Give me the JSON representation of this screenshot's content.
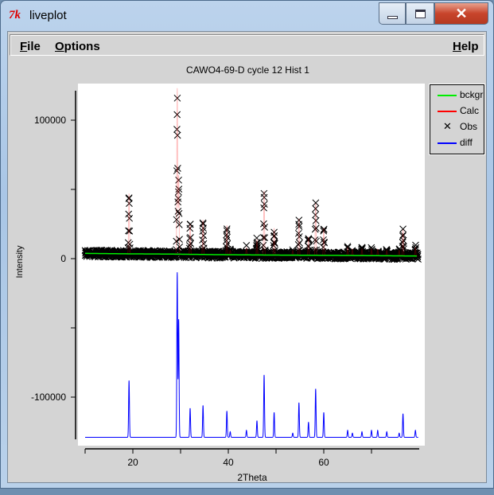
{
  "window": {
    "title": "liveplot",
    "icon": "tk-feather-icon",
    "buttons": [
      "minimize",
      "maximize",
      "close"
    ]
  },
  "menu": {
    "file": "File",
    "options": "Options",
    "help": "Help"
  },
  "chart_data": {
    "type": "line",
    "title": "CAWO4-69-D cycle 12 Hist 1",
    "xlabel": "2Theta",
    "ylabel": "Intensity",
    "xlim": [
      10,
      80
    ],
    "ylim": [
      -131000,
      121000
    ],
    "xticks": [
      {
        "v": 20,
        "label": "20"
      },
      {
        "v": 30,
        "label": ""
      },
      {
        "v": 40,
        "label": "40"
      },
      {
        "v": 50,
        "label": ""
      },
      {
        "v": 60,
        "label": "60"
      },
      {
        "v": 70,
        "label": ""
      }
    ],
    "yticks": [
      {
        "v": 100000,
        "label": "100000"
      },
      {
        "v": 50000,
        "label": ""
      },
      {
        "v": 0,
        "label": "0"
      },
      {
        "v": -50000,
        "label": ""
      },
      {
        "v": -100000,
        "label": "-100000"
      }
    ],
    "legend": {
      "placement": "right",
      "entries": [
        {
          "name": "bckgr",
          "color": "#00ee00",
          "marker": "line"
        },
        {
          "name": "Calc",
          "color": "#ff0000",
          "marker": "line"
        },
        {
          "name": "Obs",
          "color": "#000000",
          "marker": "x"
        },
        {
          "name": "diff",
          "color": "#0000ff",
          "marker": "line"
        }
      ]
    },
    "background": {
      "x": [
        10,
        18,
        28,
        37,
        48,
        65,
        79.5
      ],
      "y": [
        3800,
        3500,
        3300,
        2900,
        2600,
        2300,
        1900
      ]
    },
    "diff_baseline": -129000,
    "peaks": [
      {
        "pos": 19.2,
        "obs": 47000,
        "diff": -88000
      },
      {
        "pos": 29.3,
        "obs": 123000,
        "diff": -10000
      },
      {
        "pos": 29.6,
        "obs": 60000,
        "diff": -44000
      },
      {
        "pos": 32.0,
        "obs": 25000,
        "diff": -108000
      },
      {
        "pos": 34.7,
        "obs": 28000,
        "diff": -106000
      },
      {
        "pos": 39.7,
        "obs": 24000,
        "diff": -110000
      },
      {
        "pos": 40.4,
        "obs": 6000,
        "diff": -125000
      },
      {
        "pos": 43.8,
        "obs": 8000,
        "diff": -124000
      },
      {
        "pos": 46.0,
        "obs": 14000,
        "diff": -117000
      },
      {
        "pos": 47.5,
        "obs": 49000,
        "diff": -84000
      },
      {
        "pos": 49.6,
        "obs": 22000,
        "diff": -111000
      },
      {
        "pos": 53.5,
        "obs": 6000,
        "diff": -126000
      },
      {
        "pos": 54.8,
        "obs": 29000,
        "diff": -104000
      },
      {
        "pos": 56.8,
        "obs": 16000,
        "diff": -118000
      },
      {
        "pos": 58.3,
        "obs": 40000,
        "diff": -94000
      },
      {
        "pos": 60.0,
        "obs": 22000,
        "diff": -111000
      },
      {
        "pos": 65.0,
        "obs": 8000,
        "diff": -124000
      },
      {
        "pos": 66.0,
        "obs": 7000,
        "diff": -126000
      },
      {
        "pos": 68.0,
        "obs": 7000,
        "diff": -125000
      },
      {
        "pos": 70.0,
        "obs": 7000,
        "diff": -124000
      },
      {
        "pos": 71.3,
        "obs": 7000,
        "diff": -124000
      },
      {
        "pos": 73.2,
        "obs": 6000,
        "diff": -125000
      },
      {
        "pos": 75.8,
        "obs": 6000,
        "diff": -126000
      },
      {
        "pos": 76.6,
        "obs": 21000,
        "diff": -112000
      },
      {
        "pos": 79.2,
        "obs": 8000,
        "diff": -124000
      }
    ]
  }
}
